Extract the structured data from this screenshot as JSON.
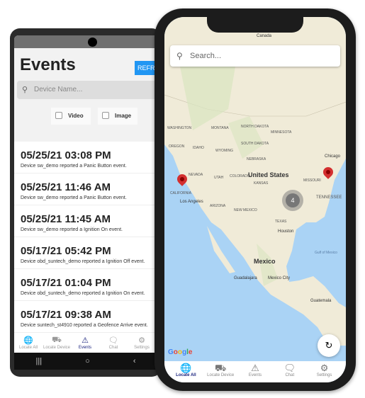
{
  "android": {
    "title": "Events",
    "refresh_label": "REFRESH",
    "search_placeholder": "Device Name...",
    "filters": [
      "Video",
      "Image"
    ],
    "events": [
      {
        "time": "05/25/21 03:08 PM",
        "desc": "Device sw_demo reported a Panic Button event."
      },
      {
        "time": "05/25/21 11:46 AM",
        "desc": "Device sw_demo reported a Panic Button event."
      },
      {
        "time": "05/25/21 11:45 AM",
        "desc": "Device sw_demo reported a Ignition On event."
      },
      {
        "time": "05/17/21 05:42 PM",
        "desc": "Device obd_suntech_demo reported a Ignition Off event."
      },
      {
        "time": "05/17/21 01:04 PM",
        "desc": "Device obd_suntech_demo reported a Ignition On event."
      },
      {
        "time": "05/17/21 09:38 AM",
        "desc": "Device suntech_st4910 reported a Geofence Arrive event."
      }
    ],
    "tabs": [
      {
        "label": "Locate All",
        "icon": "globe-icon"
      },
      {
        "label": "Locate Device",
        "icon": "truck-icon"
      },
      {
        "label": "Events",
        "icon": "warning-icon",
        "active": true
      },
      {
        "label": "Chat",
        "icon": "chat-icon"
      },
      {
        "label": "Settings",
        "icon": "gear-icon"
      }
    ]
  },
  "iphone": {
    "search_placeholder": "Search...",
    "cluster_count": "4",
    "map_attribution": "Google",
    "map_labels": {
      "canada": "Canada",
      "us": "United States",
      "mexico": "Mexico",
      "washington": "WASHINGTON",
      "montana": "MONTANA",
      "north_dakota": "NORTH DAKOTA",
      "minnesota": "MINNESOTA",
      "oregon": "OREGON",
      "idaho": "IDAHO",
      "wyoming": "WYOMING",
      "south_dakota": "SOUTH DAKOTA",
      "nebraska": "NEBRASKA",
      "nevada": "NEVADA",
      "utah": "UTAH",
      "colorado": "COLORADO",
      "kansas": "KANSAS",
      "california": "CALIFORNIA",
      "arizona": "ARIZONA",
      "new_mexico": "NEW MEXICO",
      "texas": "TEXAS",
      "missouri": "MISSOURI",
      "tennessee": "TENNESSEE",
      "chicago": "Chicago",
      "los_angeles": "Los Angeles",
      "houston": "Houston",
      "gulf": "Gulf of Mexico",
      "guadalajara": "Guadalajara",
      "mexico_city": "Mexico City",
      "guatemala": "Guatemala"
    },
    "tabs": [
      {
        "label": "Locate All",
        "icon": "globe-icon",
        "active": true
      },
      {
        "label": "Locate Device",
        "icon": "truck-icon"
      },
      {
        "label": "Events",
        "icon": "warning-icon"
      },
      {
        "label": "Chat",
        "icon": "chat-icon"
      },
      {
        "label": "Settings",
        "icon": "gear-icon"
      }
    ]
  },
  "colors": {
    "accent": "#1a237e",
    "refresh": "#2196f3",
    "pin": "#d32f2f"
  }
}
